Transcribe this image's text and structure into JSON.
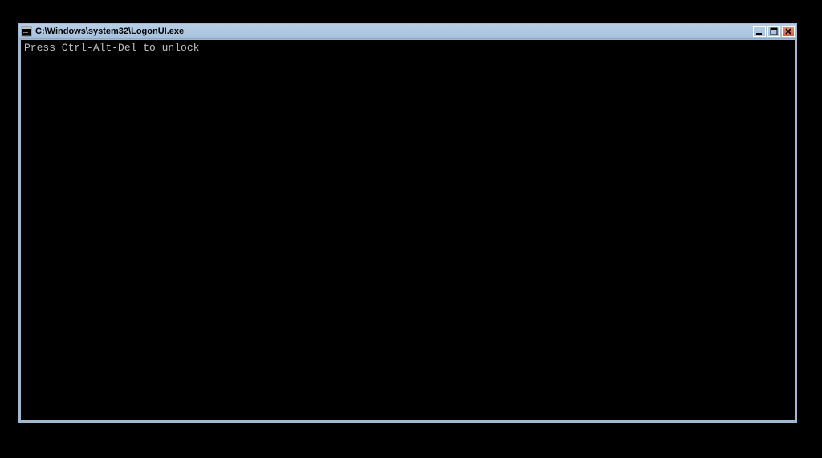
{
  "window": {
    "title": "C:\\Windows\\system32\\LogonUI.exe"
  },
  "console": {
    "line1": "Press Ctrl-Alt-Del to unlock"
  }
}
